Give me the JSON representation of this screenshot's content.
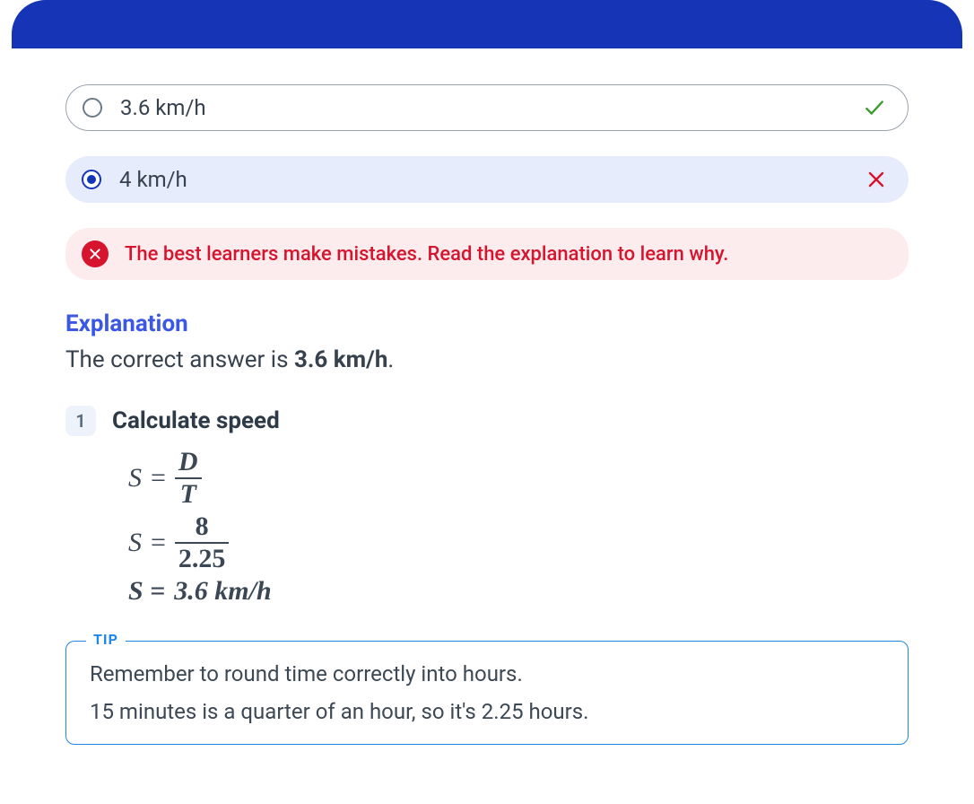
{
  "options": [
    {
      "label": "3.6 km/h",
      "selected": false,
      "correct": true
    },
    {
      "label": "4 km/h",
      "selected": true,
      "correct": false
    }
  ],
  "feedback": {
    "message": "The best learners make mistakes. Read the explanation to learn why."
  },
  "explanation": {
    "title": "Explanation",
    "answer_prefix": "The correct answer is ",
    "answer_value": "3.6 km/h",
    "answer_suffix": ".",
    "step_number": "1",
    "step_title": "Calculate speed",
    "formula_S": "S",
    "formula_eq": "=",
    "formula_D": "D",
    "formula_T": "T",
    "numeric_top": "8",
    "numeric_bot": "2.25",
    "result_prefix": "S = ",
    "result_value": "3.6 km/h"
  },
  "tip": {
    "label": "TIP",
    "line1": "Remember to round time correctly into hours.",
    "line2": "15 minutes is a quarter of an hour, so it's 2.25 hours."
  },
  "colors": {
    "header": "#1534b6",
    "error": "#d7142e",
    "tipBorder": "#1e88e5",
    "check": "#3a9a2e"
  }
}
